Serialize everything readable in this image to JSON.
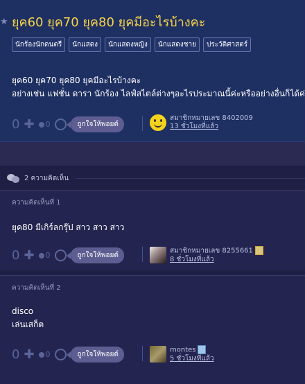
{
  "topic": {
    "title": "ยุค60 ยุค70 ยุค80 ยุคมีอะไรบ้างคะ",
    "tags": [
      "นักร้องนักดนตรี",
      "นักแสดง",
      "นักแสดงหญิง",
      "นักแสดงชาย",
      "ประวัติศาสตร์"
    ],
    "body_line1": "ยุค60 ยุค70 ยุค80 ยุคมีอะไรบ้างคะ",
    "body_line2": "อย่างเช่น แฟชั่น ดารา นักร้อง ไลฟ์สไตล์ต่างๆอะไรประมาณนี้ค่ะหรืออย่างอื่นก็ได้ค่ะ",
    "vote_count": "0",
    "minus_count": "0",
    "like_label": "ถูกใจให้พอยต์",
    "author": "สมาชิกหมายเลข 8402009",
    "time": "13 ชั่วโมงที่แล้ว"
  },
  "comments_header": {
    "label": "2 ความคิดเห็น"
  },
  "comments": [
    {
      "label": "ความคิดเห็นที่ 1",
      "text_line1": "ยุค80 มีเกิร์ลกรุ๊ป สาว สาว สาว",
      "vote_count": "0",
      "minus_count": "0",
      "like_label": "ถูกใจให้พอยต์",
      "author": "สมาชิกหมายเลข 8255661",
      "time": "8 ชั่วโมงที่แล้ว"
    },
    {
      "label": "ความคิดเห็นที่ 2",
      "text_line1": "disco",
      "text_line2": "เล่นเสก็ต",
      "vote_count": "0",
      "minus_count": "0",
      "like_label": "ถูกใจให้พอยต์",
      "author": "montes",
      "time": "5 ชั่วโมงที่แล้ว"
    }
  ],
  "colors": {
    "title": "#f7d54a",
    "topic_bg": "#1e2f62",
    "page_bg": "#1f1f45",
    "like_button": "#5d5d91"
  },
  "icons": {
    "star": "star-icon",
    "plus": "plus-icon",
    "minus": "minus-dot-icon",
    "point": "point-circle-icon",
    "comments": "comment-bubbles-icon",
    "badge": "member-badge-icon"
  }
}
